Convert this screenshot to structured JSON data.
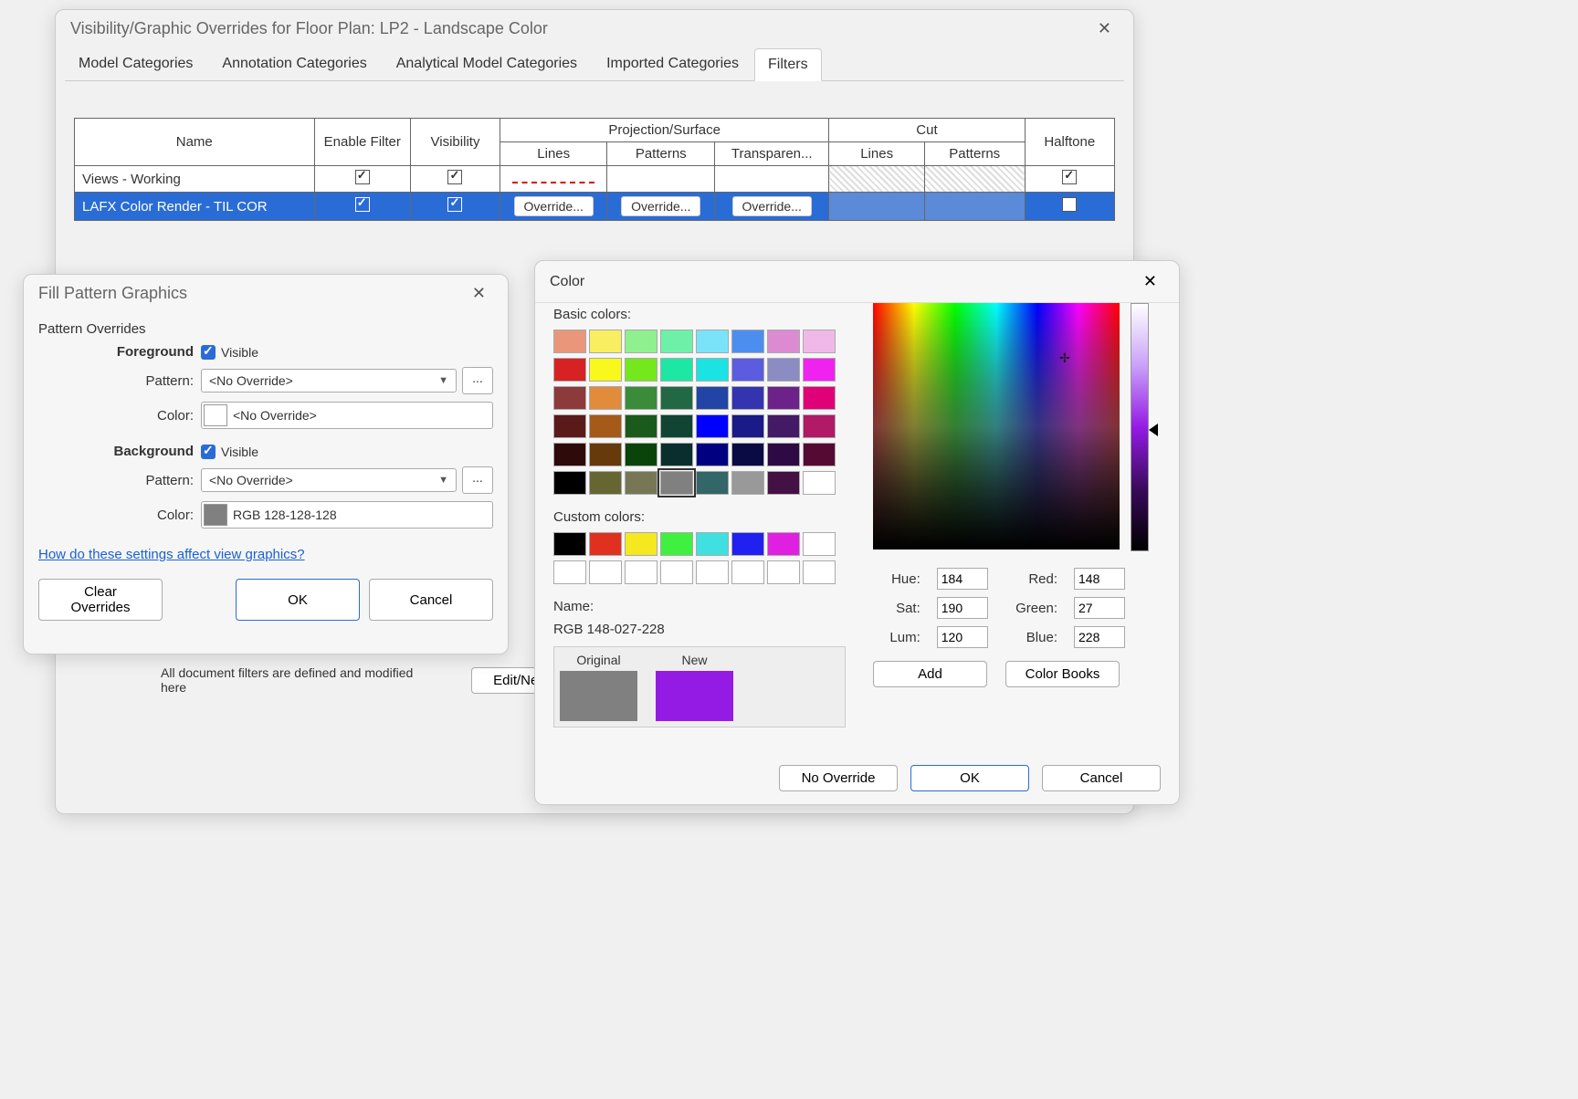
{
  "vg": {
    "title": "Visibility/Graphic Overrides for Floor Plan: LP2 - Landscape Color",
    "tabs": [
      "Model Categories",
      "Annotation Categories",
      "Analytical Model Categories",
      "Imported Categories",
      "Filters"
    ],
    "activeTab": "Filters",
    "headers": {
      "name": "Name",
      "enable": "Enable Filter",
      "visibility": "Visibility",
      "projection": "Projection/Surface",
      "proj_lines": "Lines",
      "proj_patterns": "Patterns",
      "proj_transp": "Transparen...",
      "cut": "Cut",
      "cut_lines": "Lines",
      "cut_patterns": "Patterns",
      "halftone": "Halftone"
    },
    "rows": [
      {
        "name": "Views - Working",
        "enable": true,
        "vis": true,
        "sel": false
      },
      {
        "name": "LAFX Color Render - TIL COR",
        "enable": true,
        "vis": true,
        "sel": true,
        "override": "Override..."
      }
    ],
    "helper": "All document filters are defined and modified here",
    "editBtn": "Edit/New..."
  },
  "fp": {
    "title": "Fill Pattern Graphics",
    "group": "Pattern Overrides",
    "foreground": "Foreground",
    "background": "Background",
    "visible": "Visible",
    "patternLabel": "Pattern:",
    "colorLabel": "Color:",
    "noOverride": "<No Override>",
    "bgColor": "RGB 128-128-128",
    "help": "How do these settings affect view graphics?",
    "clear": "Clear Overrides",
    "ok": "OK",
    "cancel": "Cancel",
    "ellipsis": "..."
  },
  "color": {
    "title": "Color",
    "basic": "Basic colors:",
    "custom": "Custom colors:",
    "nameLabel": "Name:",
    "nameValue": "RGB 148-027-228",
    "original": "Original",
    "new": "New",
    "hue": "Hue:",
    "hueV": "184",
    "sat": "Sat:",
    "satV": "190",
    "lum": "Lum:",
    "lumV": "120",
    "red": "Red:",
    "redV": "148",
    "green": "Green:",
    "greenV": "27",
    "blue": "Blue:",
    "blueV": "228",
    "add": "Add",
    "books": "Color Books",
    "noOverride": "No Override",
    "ok": "OK",
    "cancel": "Cancel",
    "basicColors": [
      "#e9967a",
      "#f9ed62",
      "#8ef08e",
      "#6ef0a8",
      "#7be3f9",
      "#4c8ef0",
      "#dc8bd2",
      "#f0b8e8",
      "#d62222",
      "#f8f81c",
      "#74e81c",
      "#1ce8a4",
      "#1ce3e3",
      "#5c5ce0",
      "#8c8cc4",
      "#f022f0",
      "#8c3a3a",
      "#e08c3a",
      "#3a8c3a",
      "#226844",
      "#2244a4",
      "#3434b0",
      "#6c2288",
      "#e00077",
      "#5a1a1a",
      "#a65a1a",
      "#1a5a1a",
      "#114433",
      "#0000ff",
      "#1a1a88",
      "#441a66",
      "#b01a66",
      "#2e0a0a",
      "#663a0a",
      "#0a440a",
      "#0a2e2e",
      "#000080",
      "#0a0a44",
      "#2e0a44",
      "#550a33",
      "#000000",
      "#666633",
      "#777755",
      "#808080",
      "#336666",
      "#999999",
      "#441144",
      "#ffffff"
    ],
    "customColors": [
      "#000000",
      "#e03020",
      "#f5e820",
      "#40f040",
      "#40e0e0",
      "#2020f0",
      "#e020e0",
      "#ffffff",
      "#ffffff",
      "#ffffff",
      "#ffffff",
      "#ffffff",
      "#ffffff",
      "#ffffff",
      "#ffffff",
      "#ffffff"
    ]
  }
}
